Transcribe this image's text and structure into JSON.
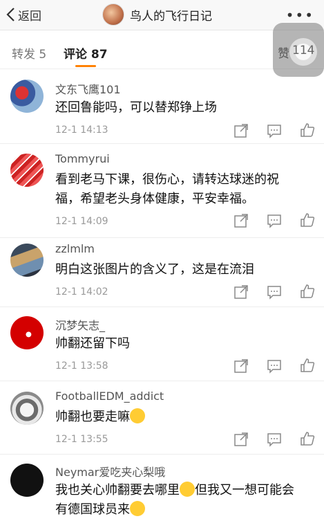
{
  "nav": {
    "back_label": "返回",
    "title": "鸟人的飞行日记",
    "more": "•••"
  },
  "tabs": {
    "repost": "转发 5",
    "comment": "评论 87",
    "like_label": "赞",
    "like_count": "114"
  },
  "comments": [
    {
      "user": "文东飞鹰101",
      "text": [
        "还回鲁能吗，可以替郑铮上场"
      ],
      "time": "12-1 14:13"
    },
    {
      "user": "Tommyrui",
      "text": [
        "看到老马下课，很伤心，请转达球迷的祝",
        "福，希望老头身体健康，平安幸福。"
      ],
      "time": "12-1 14:09"
    },
    {
      "user": "zzlmlm",
      "text": [
        "明白这张图片的含义了，这是在流泪"
      ],
      "time": "12-1 14:02"
    },
    {
      "user": "沉梦矢志_",
      "text": [
        "帅翻还留下吗"
      ],
      "time": "12-1 13:58"
    },
    {
      "user": "FootballEDM_addict",
      "text": [
        "帅翻也要走嘛"
      ],
      "time": "12-1 13:55"
    },
    {
      "user": "Neymar爱吃夹心梨哦",
      "text": [
        "我也关心帅翻要去哪里",
        "但我又一想可能会",
        "有德国球员来"
      ],
      "time": ""
    }
  ],
  "colors": {
    "accent": "#ff8200",
    "icon": "#888888"
  }
}
